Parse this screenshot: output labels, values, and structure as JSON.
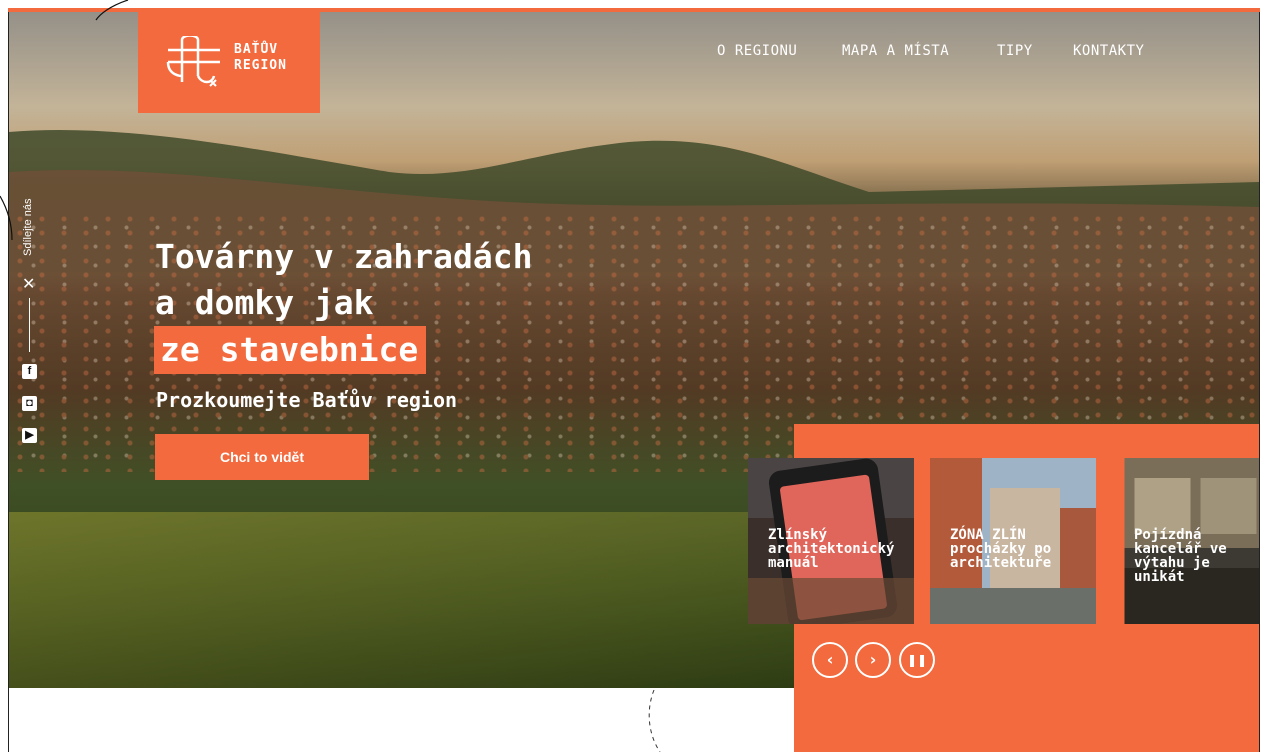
{
  "brand": {
    "line1": "BAŤŮV",
    "line2": "REGION",
    "color": "#f26a3d"
  },
  "nav": {
    "items": [
      "O REGIONU",
      "MAPA A MÍSTA",
      "TIPY",
      "KONTAKTY"
    ]
  },
  "share": {
    "label": "Sdílejte nás",
    "close_icon": "close-icon",
    "social": [
      {
        "name": "facebook-icon",
        "glyph": "f"
      },
      {
        "name": "instagram-icon",
        "glyph": "◘"
      },
      {
        "name": "youtube-icon",
        "glyph": "▶"
      }
    ]
  },
  "hero": {
    "line1": "Továrny v zahradách",
    "line2": "a domky jak",
    "highlight": "ze stavebnice",
    "subtitle": "Prozkoumejte Baťův region",
    "cta": "Chci to vidět"
  },
  "cards": [
    {
      "title": "Zlínský architektonický manuál"
    },
    {
      "title": "ZÓNA ZLÍN procházky po architektuře"
    },
    {
      "title": "Pojízdná kancelář ve výtahu je unikát"
    }
  ],
  "carousel": {
    "prev_icon": "chevron-left-icon",
    "next_icon": "chevron-right-icon",
    "pause_icon": "pause-icon"
  }
}
